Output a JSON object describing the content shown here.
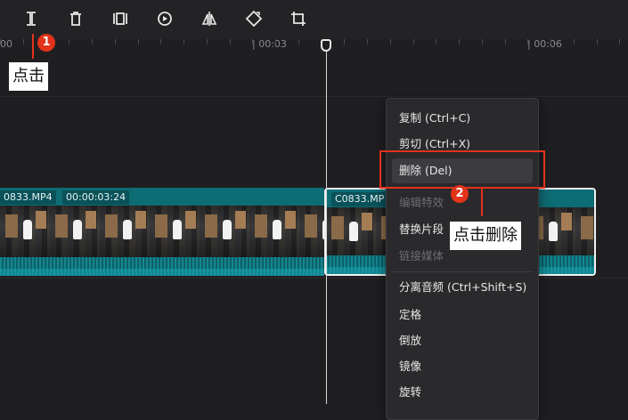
{
  "toolbar": {
    "tools": [
      {
        "name": "split-icon",
        "label": "split"
      },
      {
        "name": "delete-icon",
        "label": "delete"
      },
      {
        "name": "freeze-frame-icon",
        "label": "freeze"
      },
      {
        "name": "reverse-play-icon",
        "label": "play"
      },
      {
        "name": "mirror-icon",
        "label": "mirror"
      },
      {
        "name": "rotate-icon",
        "label": "rotate"
      },
      {
        "name": "crop-icon",
        "label": "crop"
      }
    ]
  },
  "ruler": {
    "labels": [
      "00",
      "| 00:03",
      "| 00:06"
    ]
  },
  "timeline": {
    "clip_left": {
      "name": "0833.MP4",
      "duration": "00:00:03:24"
    },
    "clip_right": {
      "name": "C0833.MP"
    }
  },
  "context_menu": {
    "items": [
      {
        "label": "复制 (Ctrl+C)",
        "enabled": true
      },
      {
        "label": "剪切 (Ctrl+X)",
        "enabled": true
      },
      {
        "label": "删除 (Del)",
        "enabled": true,
        "highlighted": true
      },
      {
        "label": "编辑特效",
        "enabled": false
      },
      {
        "label": "替换片段",
        "enabled": true
      },
      {
        "label": "链接媒体",
        "enabled": false
      },
      {
        "label": "分离音频 (Ctrl+Shift+S)",
        "enabled": true
      },
      {
        "label": "定格",
        "enabled": true
      },
      {
        "label": "倒放",
        "enabled": true
      },
      {
        "label": "镜像",
        "enabled": true
      },
      {
        "label": "旋转",
        "enabled": true
      }
    ]
  },
  "annotations": {
    "step1": {
      "number": "1",
      "text": "点击"
    },
    "step2": {
      "number": "2",
      "text": "点击删除"
    }
  },
  "colors": {
    "accent": "#e2331b",
    "clip": "#0d6068",
    "background": "#1f1f22"
  }
}
